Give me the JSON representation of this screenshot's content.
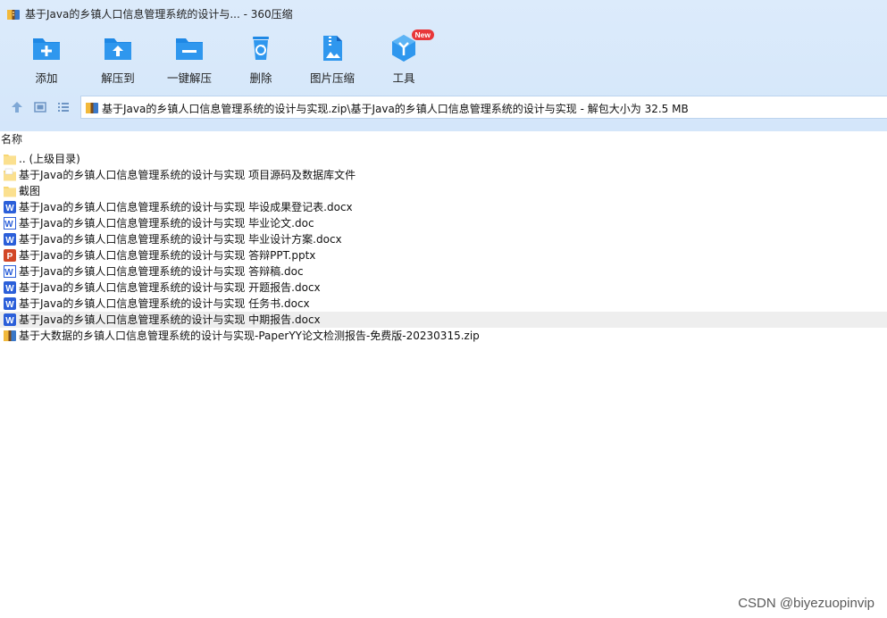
{
  "window": {
    "title": "基于Java的乡镇人口信息管理系统的设计与... - 360压缩"
  },
  "toolbar": {
    "items": [
      {
        "label": "添加",
        "icon": "add-folder-icon"
      },
      {
        "label": "解压到",
        "icon": "extract-to-icon"
      },
      {
        "label": "一键解压",
        "icon": "one-click-extract-icon"
      },
      {
        "label": "删除",
        "icon": "recycle-bin-icon"
      },
      {
        "label": "图片压缩",
        "icon": "image-compress-icon"
      },
      {
        "label": "工具",
        "icon": "tools-icon",
        "badge": "New"
      }
    ]
  },
  "nav": {
    "up_icon": "up-arrow-icon",
    "thumb_view_icon": "thumbnail-view-icon",
    "list_view_icon": "list-view-icon"
  },
  "address": {
    "path": "基于Java的乡镇人口信息管理系统的设计与实现.zip\\基于Java的乡镇人口信息管理系统的设计与实现 - 解包大小为 32.5 MB"
  },
  "columns": {
    "name": "名称"
  },
  "files": [
    {
      "name": ".. (上级目录)",
      "type": "folder"
    },
    {
      "name": "基于Java的乡镇人口信息管理系统的设计与实现 项目源码及数据库文件",
      "type": "folder-doc"
    },
    {
      "name": "截图",
      "type": "folder"
    },
    {
      "name": "基于Java的乡镇人口信息管理系统的设计与实现 毕设成果登记表.docx",
      "type": "docx"
    },
    {
      "name": "基于Java的乡镇人口信息管理系统的设计与实现 毕业论文.doc",
      "type": "doc"
    },
    {
      "name": "基于Java的乡镇人口信息管理系统的设计与实现 毕业设计方案.docx",
      "type": "docx"
    },
    {
      "name": "基于Java的乡镇人口信息管理系统的设计与实现 答辩PPT.pptx",
      "type": "pptx"
    },
    {
      "name": "基于Java的乡镇人口信息管理系统的设计与实现 答辩稿.doc",
      "type": "doc"
    },
    {
      "name": "基于Java的乡镇人口信息管理系统的设计与实现 开题报告.docx",
      "type": "docx"
    },
    {
      "name": "基于Java的乡镇人口信息管理系统的设计与实现 任务书.docx",
      "type": "docx"
    },
    {
      "name": "基于Java的乡镇人口信息管理系统的设计与实现 中期报告.docx",
      "type": "docx",
      "highlighted": true
    },
    {
      "name": "基于大数据的乡镇人口信息管理系统的设计与实现-PaperYY论文检测报告-免费版-20230315.zip",
      "type": "zip"
    }
  ],
  "watermark": "CSDN @biyezuopinvip",
  "colors": {
    "toolbar_bg": "#d4e6fa",
    "icon_blue": "#1e88e5",
    "badge_red": "#e8373a",
    "word_blue": "#2b5fd9",
    "ppt_red": "#d24726",
    "folder_yellow": "#f7d774"
  }
}
